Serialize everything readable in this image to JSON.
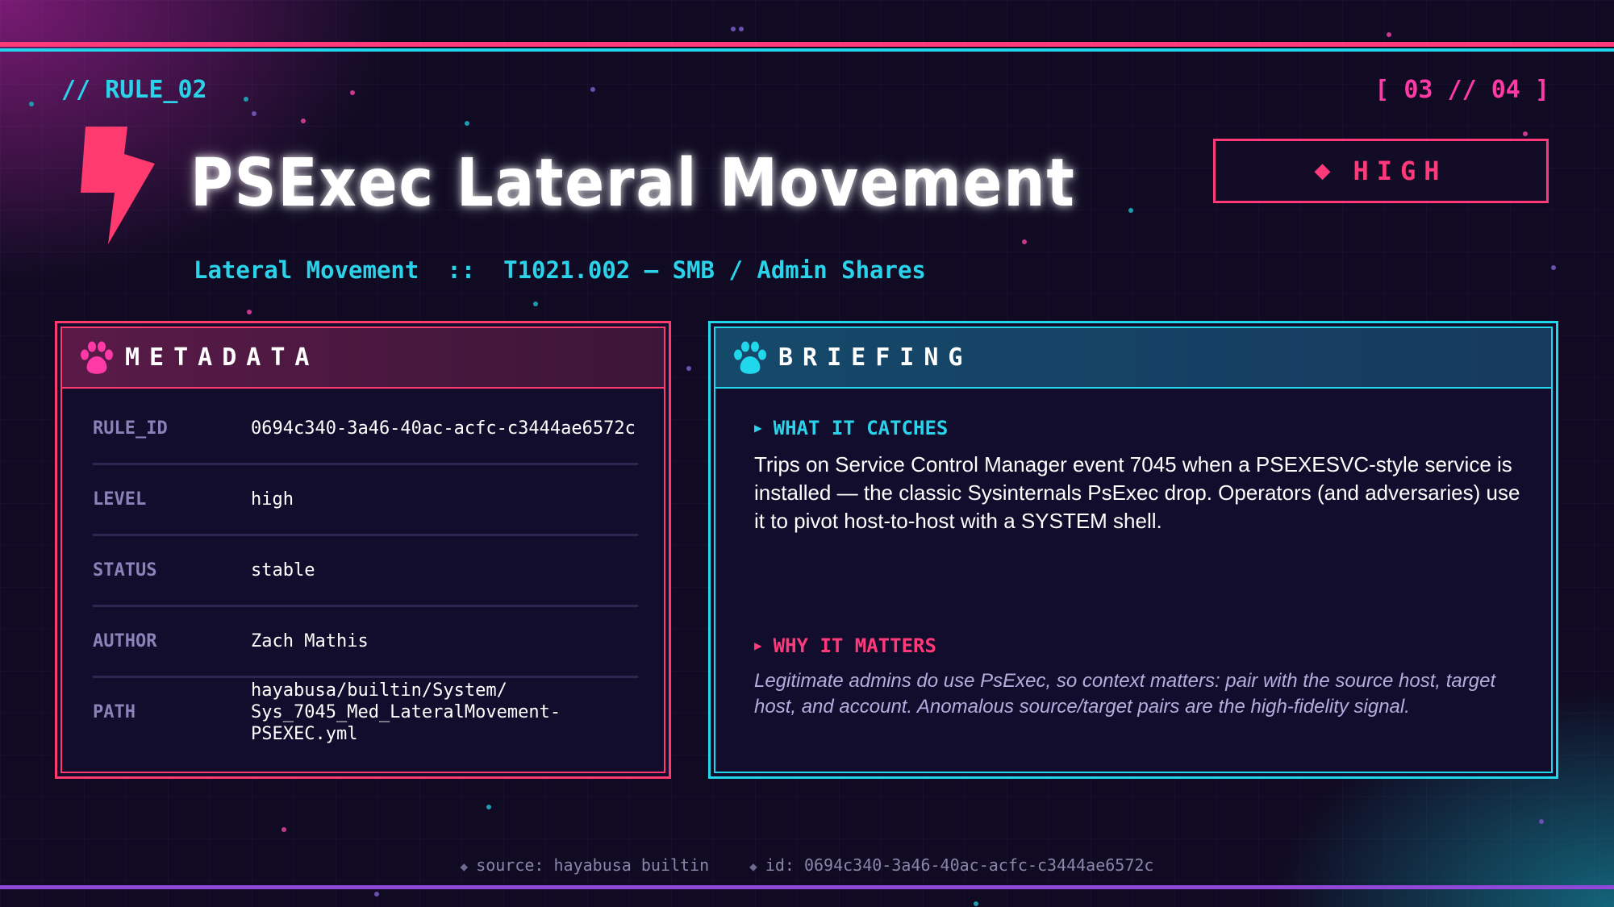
{
  "header": {
    "rule_tag": "// RULE_02",
    "page_counter": "[ 03 // 04 ]"
  },
  "title": "PSExec Lateral Movement",
  "subtitle": "Lateral Movement  ::  T1021.002 — SMB / Admin Shares",
  "severity": {
    "label": "HIGH",
    "icon": "diamond-icon"
  },
  "icons": {
    "title_icon": "lightning-bolt-icon",
    "panel_icon": "paw-icon"
  },
  "colors": {
    "accent_pink": "#ff3a7a",
    "accent_cyan": "#21d7ec",
    "accent_purple": "#8f48d8",
    "background": "#100b22"
  },
  "metadata": {
    "title": "METADATA",
    "rows": [
      {
        "key": "RULE_ID",
        "value": "0694c340-3a46-40ac-acfc-c3444ae6572c"
      },
      {
        "key": "LEVEL",
        "value": "high"
      },
      {
        "key": "STATUS",
        "value": "stable"
      },
      {
        "key": "AUTHOR",
        "value": "Zach Mathis"
      },
      {
        "key": "PATH",
        "value": "hayabusa/builtin/System/ Sys_7045_Med_LateralMovement-PSEXEC.yml"
      }
    ]
  },
  "briefing": {
    "title": "BRIEFING",
    "what_it_catches": {
      "label": "WHAT IT CATCHES",
      "text": "Trips on Service Control Manager event 7045 when a PSEXESVC-style service is installed — the classic Sysinternals PsExec drop. Operators (and adversaries) use it to pivot host-to-host with a SYSTEM shell."
    },
    "why_it_matters": {
      "label": "WHY IT MATTERS",
      "text": "Legitimate admins do use PsExec, so context matters: pair with the source host, target host, and account. Anomalous source/target pairs are the high-fidelity signal."
    }
  },
  "footer": {
    "source": "source: hayabusa builtin",
    "id": "id: 0694c340-3a46-40ac-acfc-c3444ae6572c"
  }
}
